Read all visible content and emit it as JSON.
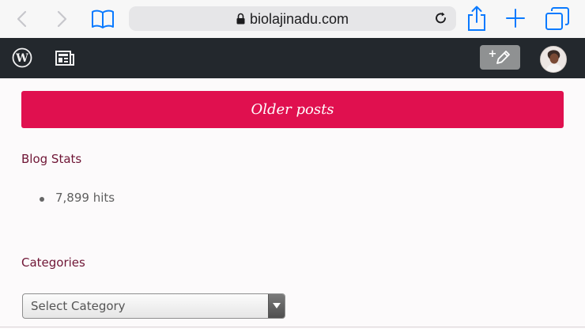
{
  "browser": {
    "url": "biolajinadu.com",
    "icons": [
      "back-icon",
      "forward-icon",
      "bookmarks-icon",
      "lock-icon",
      "reload-icon",
      "share-icon",
      "new-tab-icon",
      "tabs-icon"
    ]
  },
  "admin_bar": {
    "icons": [
      "wordpress-logo-icon",
      "reader-icon",
      "write-post-icon"
    ],
    "write_label": "+"
  },
  "main": {
    "older_posts_label": "Older posts",
    "blog_stats_title": "Blog Stats",
    "stats": [
      {
        "text": "7,899 hits"
      }
    ],
    "categories_title": "Categories",
    "category_select_value": "Select Category"
  },
  "colors": {
    "accent": "#e0104f",
    "heading": "#6f1535",
    "admin_bar_bg": "#23282d",
    "safari_bar_bg": "#f7f7f7"
  }
}
